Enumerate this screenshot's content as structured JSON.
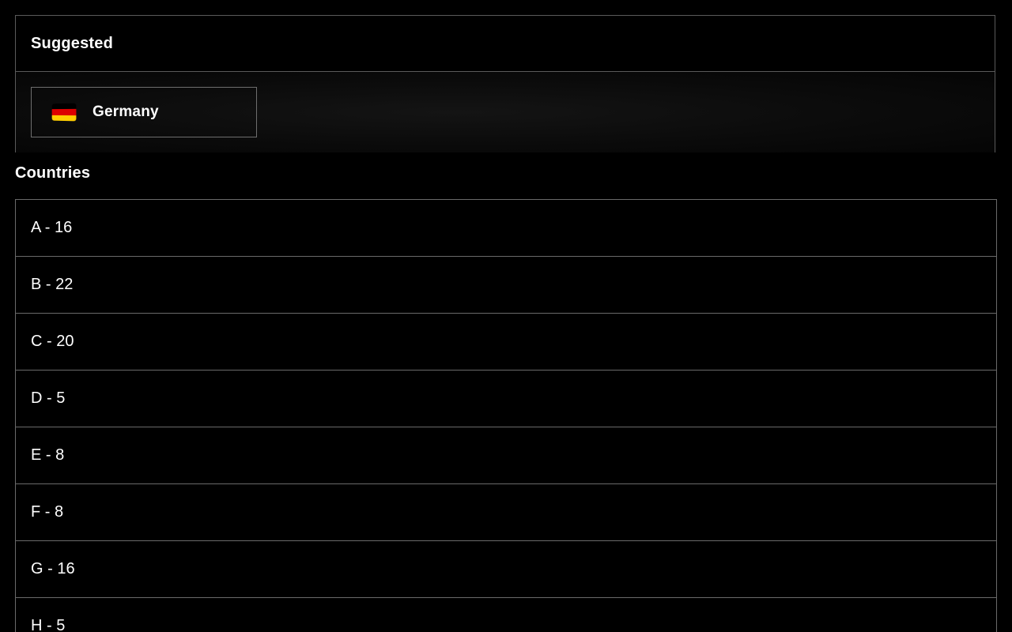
{
  "suggested": {
    "title": "Suggested",
    "items": [
      {
        "label": "Germany",
        "icon": "germany-flag-icon",
        "flag_colors": [
          "#000000",
          "#dd0000",
          "#ffce00"
        ]
      }
    ]
  },
  "countries": {
    "title": "Countries",
    "groups": [
      {
        "label": "A - 16"
      },
      {
        "label": "B - 22"
      },
      {
        "label": "C - 20"
      },
      {
        "label": "D - 5"
      },
      {
        "label": "E - 8"
      },
      {
        "label": "F - 8"
      },
      {
        "label": "G - 16"
      },
      {
        "label": "H - 5"
      }
    ]
  }
}
